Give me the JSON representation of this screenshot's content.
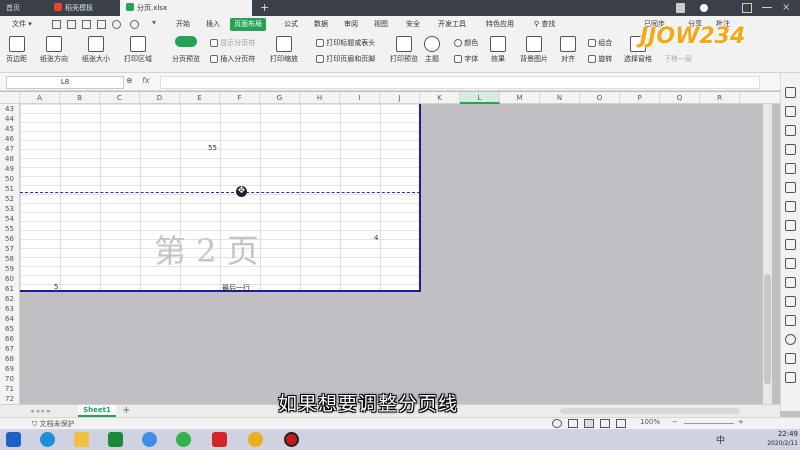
{
  "window_tabs": [
    {
      "label": "首页"
    },
    {
      "label": "稻壳模板"
    },
    {
      "label": "分页.xlsx"
    }
  ],
  "new_tab": "+",
  "menu": {
    "file": "文件",
    "items": [
      "开始",
      "插入",
      "页面布局",
      "公式",
      "数据",
      "审阅",
      "视图",
      "安全",
      "开发工具",
      "特色应用"
    ],
    "search": "查找",
    "sync": "已同步",
    "share": "分享",
    "comment": "批注"
  },
  "ribbon": {
    "margins": "页边距",
    "orientation": "纸张方向",
    "size": "纸张大小",
    "print_area": "打印区域",
    "page_break_preview": "分页预览",
    "show_page_breaks": "显示分页符",
    "insert_page_break": "插入分页符",
    "print_zoom": "打印缩放",
    "print_titles": "打印标题或表头",
    "header_footer": "打印页眉和页脚",
    "print_preview": "打印预览",
    "theme": "主题",
    "colors": "颜色",
    "fonts": "字体",
    "effects": "效果",
    "background": "背景图片",
    "align": "对齐",
    "group": "组合",
    "rotate": "旋转",
    "selection_pane": "选择窗格",
    "send_backward": "下移一层"
  },
  "name_box": "L8",
  "formula_icons": {
    "zoom": "⊕",
    "fx": "fx"
  },
  "columns": [
    "A",
    "B",
    "C",
    "D",
    "E",
    "F",
    "G",
    "H",
    "I",
    "J",
    "K",
    "L",
    "M",
    "N",
    "O",
    "P",
    "Q",
    "R"
  ],
  "selected_column": "L",
  "rows": [
    "43",
    "44",
    "45",
    "46",
    "47",
    "48",
    "49",
    "50",
    "51",
    "52",
    "53",
    "54",
    "55",
    "56",
    "57",
    "58",
    "59",
    "60",
    "61",
    "62",
    "63",
    "64",
    "65",
    "66",
    "67",
    "68",
    "69",
    "70",
    "71",
    "72"
  ],
  "cells": {
    "e47": "55",
    "i56": "4",
    "b61": "5",
    "f61": "最后一行"
  },
  "page_watermark": "第 2 页",
  "sheet": {
    "name": "Sheet1",
    "add": "+"
  },
  "status": {
    "protect": "文档未保护",
    "zoom": "100%"
  },
  "clock": {
    "time": "22:49",
    "date": "2020/2/11"
  },
  "subtitle": "如果想要调整分页线",
  "logo_text": "JJOW234"
}
